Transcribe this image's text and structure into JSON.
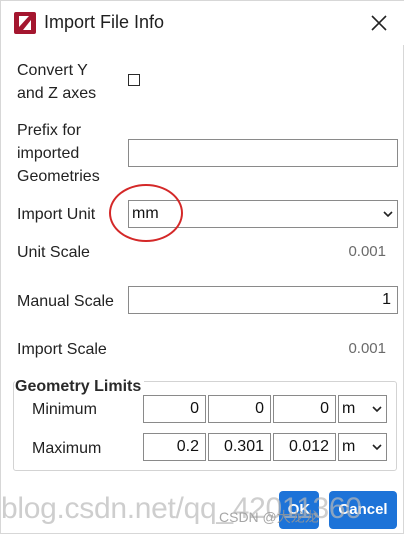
{
  "window": {
    "title": "Import File Info",
    "close_icon": "close-icon",
    "app_icon": "app-logo-icon",
    "accent_color": "#1d73d8"
  },
  "form": {
    "convert_axes_label_line1": "Convert Y",
    "convert_axes_label_line2": "and Z axes",
    "convert_axes_checked": false,
    "prefix_label_line1": "Prefix for",
    "prefix_label_line2": "imported",
    "prefix_label_line3": "Geometries",
    "prefix_value": "",
    "import_unit_label": "Import Unit",
    "import_unit_value": "mm",
    "unit_scale_label": "Unit Scale",
    "unit_scale_value": "0.001",
    "manual_scale_label": "Manual Scale",
    "manual_scale_value": "1",
    "import_scale_label": "Import Scale",
    "import_scale_value": "0.001"
  },
  "geometry_limits": {
    "title": "Geometry Limits",
    "minimum_label": "Minimum",
    "minimum_values": [
      "0",
      "0",
      "0"
    ],
    "minimum_unit": "m",
    "maximum_label": "Maximum",
    "maximum_values": [
      "0.2",
      "0.301",
      "0.012"
    ],
    "maximum_unit": "m"
  },
  "buttons": {
    "ok": "OK",
    "cancel": "Cancel"
  },
  "watermark": {
    "main": "blog.csdn.net/qq_42011360",
    "secondary": "CSDN @大龙龙"
  }
}
